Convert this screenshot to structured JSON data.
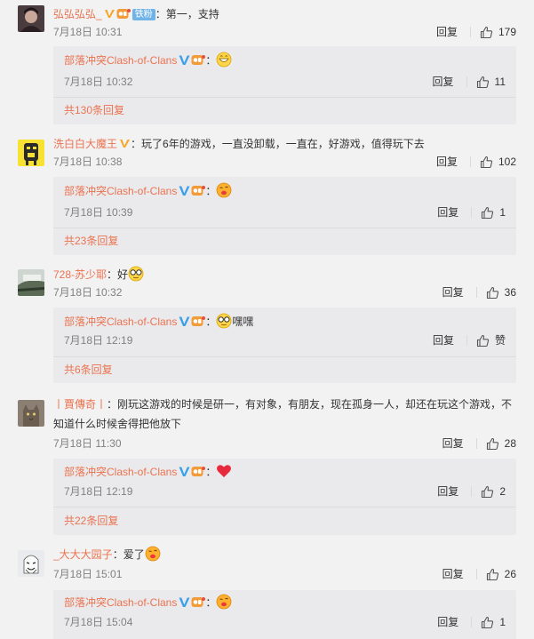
{
  "comments": [
    {
      "username": "弘弘弘弘_",
      "badge_text": "铁粉",
      "sep": "：",
      "text": "第一，支持",
      "time": "7月18日 10:31",
      "reply_label": "回复",
      "likes": "179",
      "reply": {
        "username": "部落冲突Clash-of-Clans",
        "sep": "：",
        "text": "",
        "time": "7月18日 10:32",
        "reply_label": "回复",
        "likes": "11"
      },
      "more_replies": "共130条回复"
    },
    {
      "username": "洗白白大魔王",
      "sep": "：",
      "text": "玩了6年的游戏，一直没卸载，一直在，好游戏，值得玩下去",
      "time": "7月18日 10:38",
      "reply_label": "回复",
      "likes": "102",
      "reply": {
        "username": "部落冲突Clash-of-Clans",
        "sep": "：",
        "text": "",
        "time": "7月18日 10:39",
        "reply_label": "回复",
        "likes": "1"
      },
      "more_replies": "共23条回复"
    },
    {
      "username": "728-苏少耶",
      "sep": "：",
      "text": "好",
      "time": "7月18日 10:32",
      "reply_label": "回复",
      "likes": "36",
      "reply": {
        "username": "部落冲突Clash-of-Clans",
        "sep": "：",
        "text": "嘿嘿",
        "time": "7月18日 12:19",
        "reply_label": "回复",
        "likes": "赞"
      },
      "more_replies": "共6条回复"
    },
    {
      "username": "丨賈傳奇丨",
      "sep": "：",
      "text": "刚玩这游戏的时候是研一，有对象，有朋友，现在孤身一人，却还在玩这个游戏，不知道什么时候舍得把他放下",
      "time": "7月18日 11:30",
      "reply_label": "回复",
      "likes": "28",
      "reply": {
        "username": "部落冲突Clash-of-Clans",
        "sep": "：",
        "text": "",
        "time": "7月18日 12:19",
        "reply_label": "回复",
        "likes": "2"
      },
      "more_replies": "共22条回复"
    },
    {
      "username": "_大大大园子",
      "sep": "：",
      "text": "爱了",
      "time": "7月18日 15:01",
      "reply_label": "回复",
      "likes": "26",
      "reply": {
        "username": "部落冲突Clash-of-Clans",
        "sep": "：",
        "text": "",
        "time": "7月18日 15:04",
        "reply_label": "回复",
        "likes": "1"
      }
    }
  ],
  "colors": {
    "username": "#eb7350",
    "time": "#808080",
    "reply_bg": "#eaeaec",
    "page_bg": "#f2f2f2",
    "verified": "#f6a623",
    "blue_verified": "#3aa0e8"
  }
}
